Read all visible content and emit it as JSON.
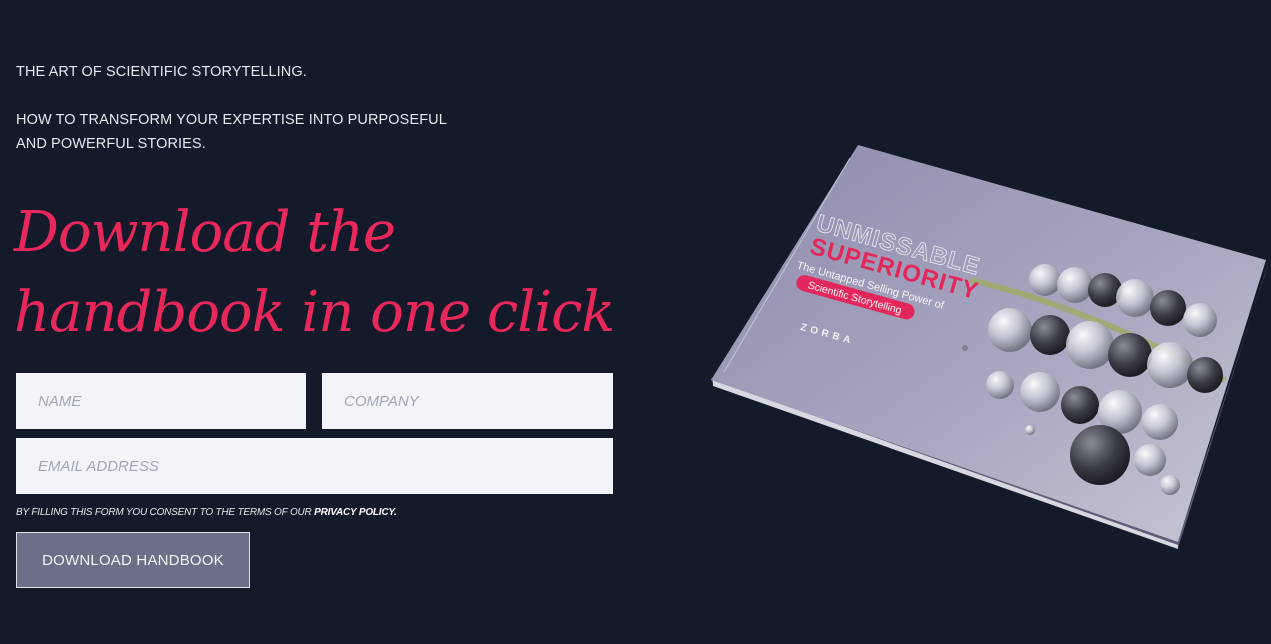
{
  "intro": {
    "line1": "THE ART OF SCIENTIFIC STORYTELLING.",
    "line2": "HOW TO TRANSFORM YOUR EXPERTISE INTO PURPOSEFUL AND POWERFUL STORIES."
  },
  "headline": {
    "line1": "Download the",
    "line2": "handbook in one click"
  },
  "form": {
    "name_placeholder": "NAME",
    "company_placeholder": "COMPANY",
    "email_placeholder": "EMAIL ADDRESS",
    "consent_text": "BY FILLING THIS FORM YOU CONSENT TO THE TERMS OF OUR ",
    "privacy_link": "PRIVACY POLICY.",
    "submit_label": "DOWNLOAD HANDBOOK"
  },
  "book": {
    "title_outline": "UNMISSABLE",
    "title_main": "SUPERIORITY",
    "subtitle": "The Untapped Selling Power of",
    "badge": "Scientific Storytelling",
    "brand": "ZORBA"
  },
  "colors": {
    "background": "#141a29",
    "accent": "#e8285a",
    "button": "#6b6f88",
    "field": "#f2f4f7"
  }
}
